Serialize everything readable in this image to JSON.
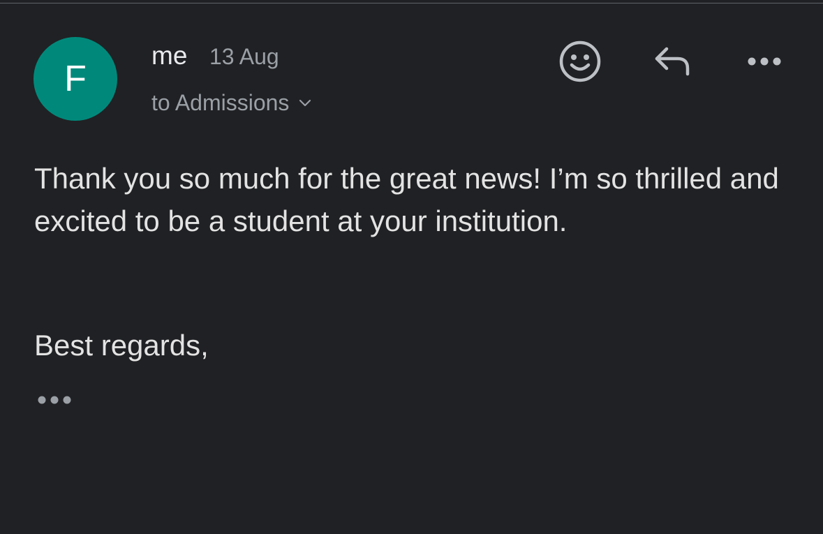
{
  "message": {
    "avatar_letter": "F",
    "sender": "me",
    "date": "13 Aug",
    "recipient": "to Admissions",
    "body": "Thank you so much for the great news! I’m so thrilled and excited to be a student at your institution.",
    "signoff": "Best regards,"
  },
  "icons": {
    "emoji": "smiley-face-icon",
    "reply": "reply-arrow-icon",
    "more": "more-horizontal-icon",
    "recipient_toggle": "chevron-down-icon",
    "quoted_text": "ellipsis-icon"
  },
  "colors": {
    "background": "#202124",
    "avatar": "#00897b",
    "primary_text": "#e3e3e3",
    "secondary_text": "#9aa0a6",
    "icon": "#bdc1c6"
  }
}
